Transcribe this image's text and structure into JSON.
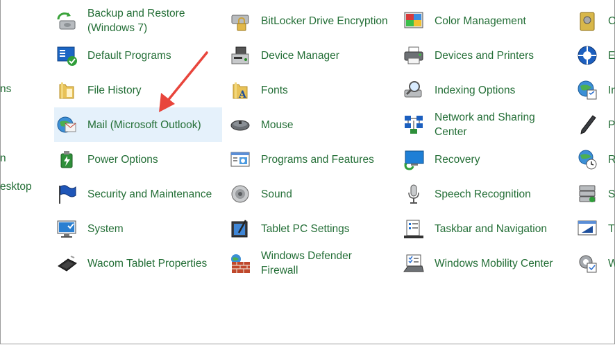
{
  "left_partial": [
    "ns",
    "n",
    "esktop"
  ],
  "columns": [
    [
      {
        "label": "Backup and Restore\n(Windows 7)",
        "icon": "backup-restore-icon"
      },
      {
        "label": "Default Programs",
        "icon": "default-programs-icon"
      },
      {
        "label": "File History",
        "icon": "file-history-icon"
      },
      {
        "label": "Mail (Microsoft Outlook)",
        "icon": "mail-icon"
      },
      {
        "label": "Power Options",
        "icon": "power-options-icon"
      },
      {
        "label": "Security and Maintenance",
        "icon": "security-flag-icon"
      },
      {
        "label": "System",
        "icon": "system-icon"
      },
      {
        "label": "Wacom Tablet Properties",
        "icon": "wacom-tablet-icon"
      }
    ],
    [
      {
        "label": "BitLocker Drive Encryption",
        "icon": "bitlocker-icon"
      },
      {
        "label": "Device Manager",
        "icon": "device-manager-icon"
      },
      {
        "label": "Fonts",
        "icon": "fonts-icon"
      },
      {
        "label": "Mouse",
        "icon": "mouse-icon"
      },
      {
        "label": "Programs and Features",
        "icon": "programs-features-icon"
      },
      {
        "label": "Sound",
        "icon": "sound-icon"
      },
      {
        "label": "Tablet PC Settings",
        "icon": "tablet-pc-icon"
      },
      {
        "label": "Windows Defender\nFirewall",
        "icon": "firewall-icon"
      }
    ],
    [
      {
        "label": "Color Management",
        "icon": "color-management-icon"
      },
      {
        "label": "Devices and Printers",
        "icon": "printer-icon"
      },
      {
        "label": "Indexing Options",
        "icon": "indexing-icon"
      },
      {
        "label": "Network and Sharing\nCenter",
        "icon": "network-icon"
      },
      {
        "label": "Recovery",
        "icon": "recovery-icon"
      },
      {
        "label": "Speech Recognition",
        "icon": "microphone-icon"
      },
      {
        "label": "Taskbar and Navigation",
        "icon": "taskbar-icon"
      },
      {
        "label": "Windows Mobility Center",
        "icon": "mobility-center-icon"
      }
    ],
    [
      {
        "label": "C",
        "icon": "credential-icon"
      },
      {
        "label": "E",
        "icon": "ease-of-access-icon"
      },
      {
        "label": "In",
        "icon": "internet-options-icon"
      },
      {
        "label": "Pe",
        "icon": "pen-touch-icon"
      },
      {
        "label": "R",
        "icon": "region-icon"
      },
      {
        "label": "S",
        "icon": "storage-spaces-icon"
      },
      {
        "label": "Tr",
        "icon": "troubleshooting-icon"
      },
      {
        "label": "W",
        "icon": "windows-tools-icon"
      }
    ]
  ],
  "selected": "Mail (Microsoft Outlook)",
  "arrow_color": "#e8453c",
  "link_color": "#236e36",
  "hover_bg": "#e5f1fb"
}
